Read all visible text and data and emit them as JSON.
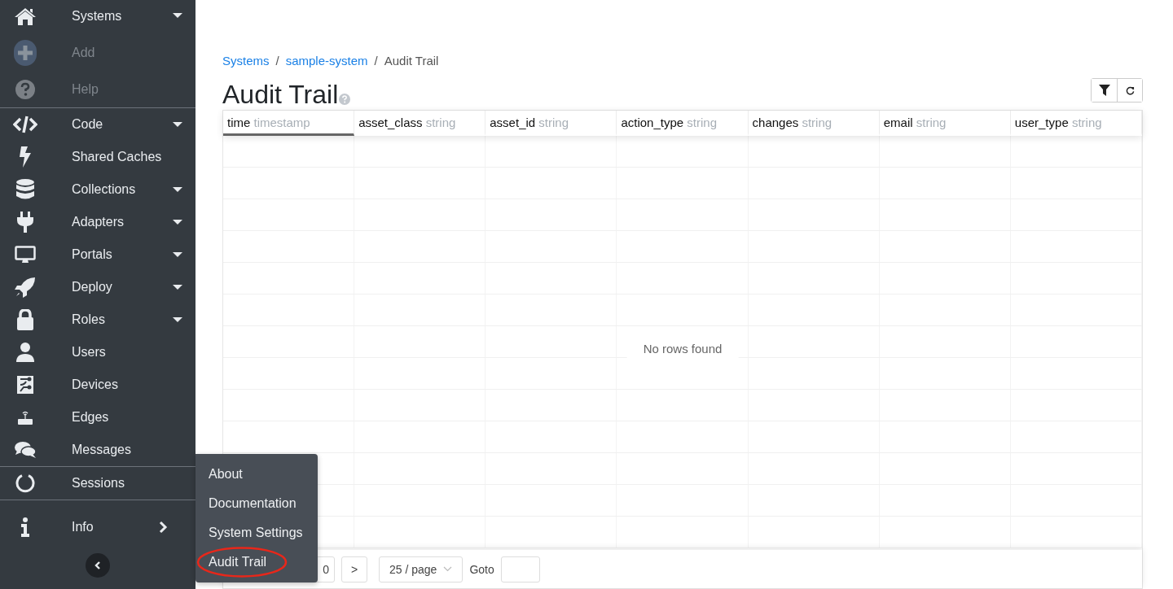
{
  "sidebar": {
    "sections": [
      {
        "items": [
          {
            "label": "Systems",
            "dropdown": true,
            "flyout": false,
            "disabled": false
          },
          {
            "label": "Add",
            "dropdown": false,
            "flyout": false,
            "disabled": true
          },
          {
            "label": "Help",
            "dropdown": false,
            "flyout": false,
            "disabled": true
          }
        ]
      },
      {
        "items": [
          {
            "label": "Code",
            "dropdown": true,
            "flyout": false,
            "disabled": false
          },
          {
            "label": "Shared Caches",
            "dropdown": false,
            "flyout": false,
            "disabled": false
          },
          {
            "label": "Collections",
            "dropdown": true,
            "flyout": false,
            "disabled": false
          },
          {
            "label": "Adapters",
            "dropdown": true,
            "flyout": false,
            "disabled": false
          },
          {
            "label": "Portals",
            "dropdown": true,
            "flyout": false,
            "disabled": false
          },
          {
            "label": "Deploy",
            "dropdown": true,
            "flyout": false,
            "disabled": false
          },
          {
            "label": "Roles",
            "dropdown": true,
            "flyout": false,
            "disabled": false
          },
          {
            "label": "Users",
            "dropdown": false,
            "flyout": false,
            "disabled": false
          },
          {
            "label": "Devices",
            "dropdown": false,
            "flyout": false,
            "disabled": false
          },
          {
            "label": "Edges",
            "dropdown": false,
            "flyout": false,
            "disabled": false
          },
          {
            "label": "Messages",
            "dropdown": false,
            "flyout": false,
            "disabled": false
          }
        ]
      },
      {
        "items": [
          {
            "label": "Sessions",
            "dropdown": false,
            "flyout": false,
            "disabled": false
          }
        ]
      },
      {
        "items": [
          {
            "label": "Info",
            "dropdown": false,
            "flyout": true,
            "disabled": false
          }
        ]
      }
    ]
  },
  "breadcrumb": [
    {
      "label": "Systems",
      "link": true
    },
    {
      "label": "sample-system",
      "link": true
    },
    {
      "label": "Audit Trail",
      "link": false
    }
  ],
  "breadcrumb_separator": "/",
  "page_title": "Audit Trail",
  "table": {
    "columns": [
      {
        "name": "time",
        "type": "timestamp",
        "sorted": true
      },
      {
        "name": "asset_class",
        "type": "string",
        "sorted": false
      },
      {
        "name": "asset_id",
        "type": "string",
        "sorted": false
      },
      {
        "name": "action_type",
        "type": "string",
        "sorted": false
      },
      {
        "name": "changes",
        "type": "string",
        "sorted": false
      },
      {
        "name": "email",
        "type": "string",
        "sorted": false
      },
      {
        "name": "user_type",
        "type": "string",
        "sorted": false
      }
    ],
    "empty_message": "No rows found"
  },
  "pagination": {
    "page": "0",
    "next": ">",
    "page_size": "25 / page",
    "goto_label": "Goto"
  },
  "info_menu": {
    "items": [
      {
        "label": "About",
        "highlighted": false
      },
      {
        "label": "Documentation",
        "highlighted": false
      },
      {
        "label": "System Settings",
        "highlighted": false
      },
      {
        "label": "Audit Trail",
        "highlighted": true
      }
    ]
  }
}
